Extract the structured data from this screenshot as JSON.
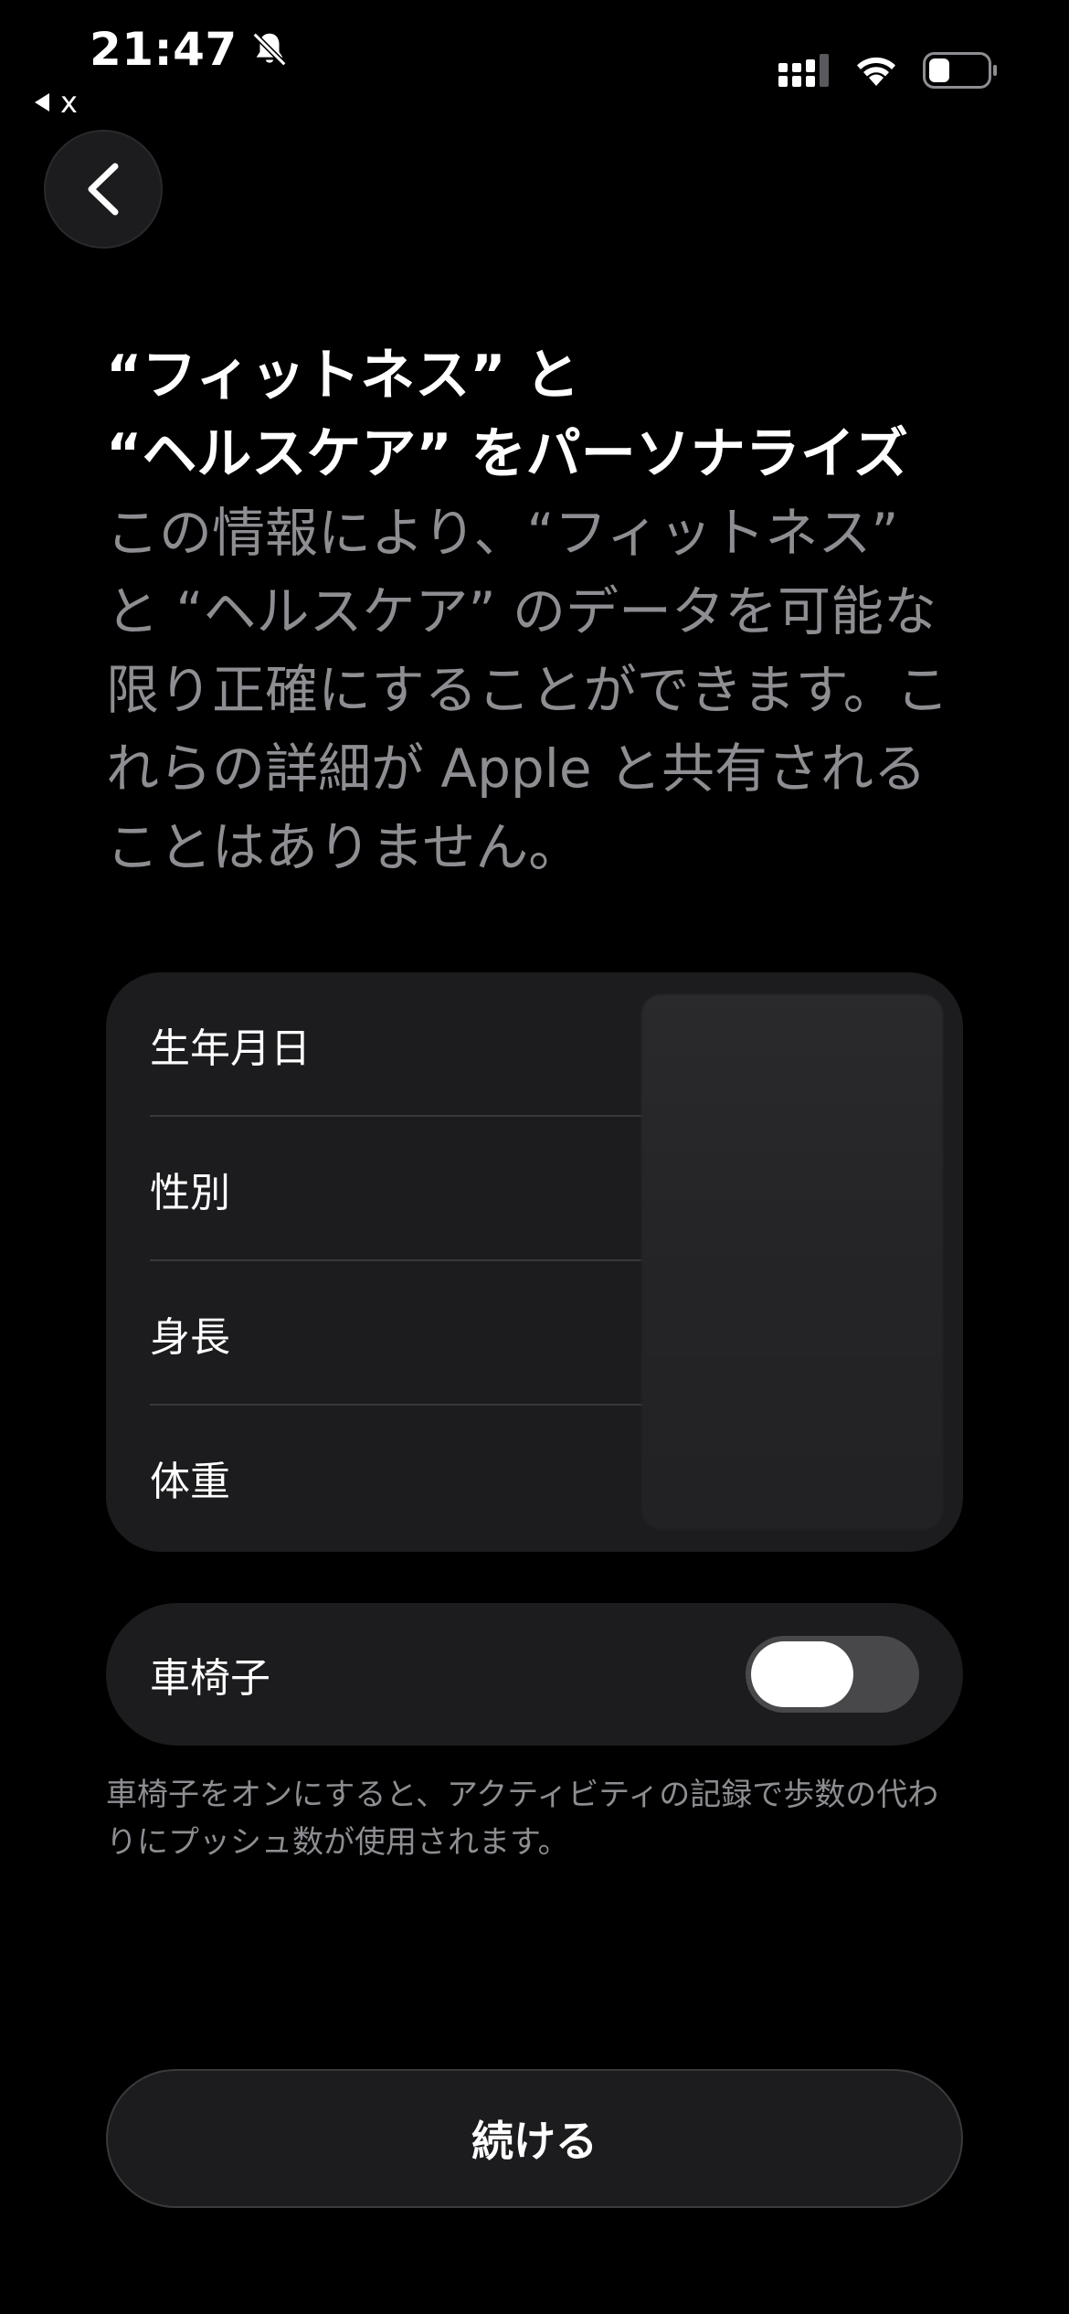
{
  "status_bar": {
    "time": "21:47",
    "back_app_label": "x",
    "icons": [
      "bell-slash-icon",
      "cellular-signal-icon",
      "wifi-icon",
      "battery-icon"
    ]
  },
  "nav": {
    "back_icon": "chevron-left-icon"
  },
  "header": {
    "title": "“フィットネス” と\n“ヘルスケア” をパーソナライズ",
    "description": "この情報により、“フィットネス” と “ヘルスケア” のデータを可能な限り正確にすることができます。これらの詳細が Apple と共有されることはありません。"
  },
  "info_list": {
    "items": [
      {
        "label": "生年月日"
      },
      {
        "label": "性別"
      },
      {
        "label": "身長"
      },
      {
        "label": "体重"
      }
    ]
  },
  "wheelchair": {
    "label": "車椅子",
    "toggle_on": false,
    "footnote": "車椅子をオンにすると、アクティビティの記録で歩数の代わりにプッシュ数が使用されます。"
  },
  "actions": {
    "continue_label": "続ける"
  },
  "colors": {
    "background": "#000000",
    "card": "#1c1c1e",
    "secondary_text": "#8d8d92",
    "toggle_track": "#48484b"
  }
}
